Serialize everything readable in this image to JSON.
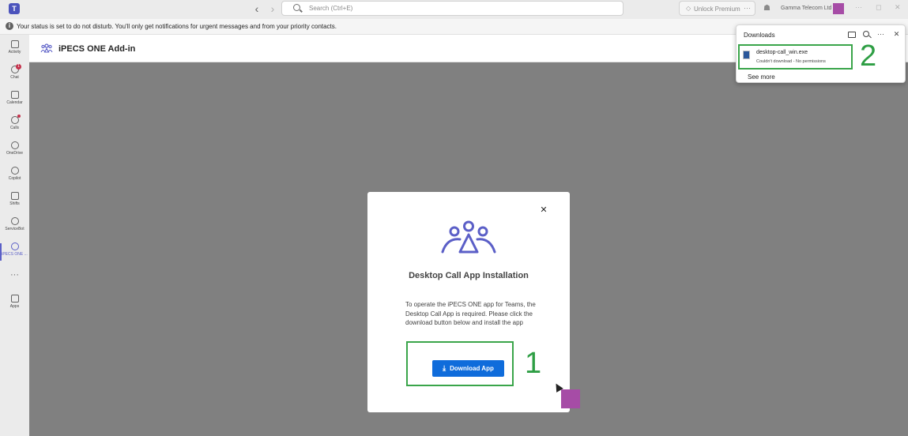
{
  "titlebar": {
    "logo": "T",
    "search_placeholder": "Search (Ctrl+E)",
    "premium_label": "Unlock Premium",
    "premium_more": "···",
    "org_name": "Gamma Telecom Ltd",
    "minimize": "–",
    "restore": "◻",
    "close": "✕",
    "more": "···",
    "back_arrow": "‹",
    "forward_arrow": "›"
  },
  "banner": {
    "info_glyph": "i",
    "text": "Your status is set to do not disturb. You'll only get notifications for urgent messages and from your priority contacts."
  },
  "sidebar": {
    "items": [
      {
        "label": "Activity"
      },
      {
        "label": "Chat",
        "badge": "1"
      },
      {
        "label": "Calendar"
      },
      {
        "label": "Calls"
      },
      {
        "label": "OneDrive"
      },
      {
        "label": "Copilot"
      },
      {
        "label": "Shifts"
      },
      {
        "label": "ServiceBot"
      },
      {
        "label": "iPECS ONE ..."
      },
      {
        "label": "Apps"
      }
    ],
    "more": "···"
  },
  "app": {
    "title": "iPECS ONE Add-in"
  },
  "modal": {
    "close": "✕",
    "title": "Desktop Call App Installation",
    "body": "To operate the iPECS ONE app for Teams, the Desktop Call App is required. Please click the download button below and install the app",
    "download_label": "Download App",
    "download_icon": "⤓",
    "marker_number": "1"
  },
  "downloads": {
    "title": "Downloads",
    "more": "···",
    "close": "✕",
    "file_name": "desktop-call_win.exe",
    "status": "Couldn't download - No permissions",
    "see_more": "See more",
    "marker_number": "2"
  },
  "colors": {
    "accent": "#5b5fc7",
    "download_button": "#0f6cdb",
    "annotation_green": "#3aa54a",
    "purple_square": "#a64ca6",
    "overlay_gray": "#808080"
  }
}
